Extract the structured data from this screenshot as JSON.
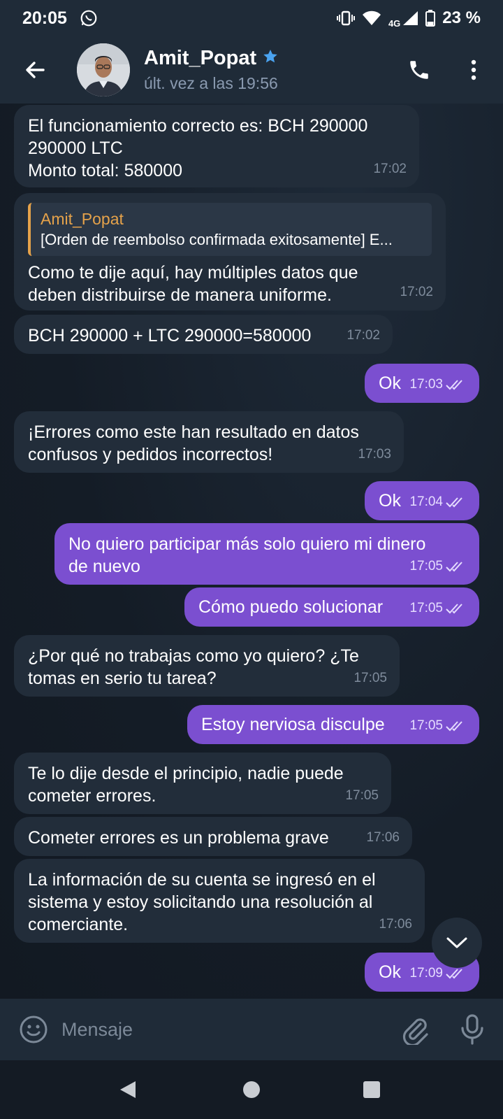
{
  "status_bar": {
    "time": "20:05",
    "network": "4G",
    "battery": "23 %"
  },
  "header": {
    "contact_name": "Amit_Popat",
    "last_seen": "últ. vez a las 19:56"
  },
  "messages": [
    {
      "dir": "in",
      "text": "El funcionamiento correcto es: BCH 290000\n290000 LTC\nMonto total: 580000",
      "time": "17:02"
    },
    {
      "dir": "in",
      "quote_name": "Amit_Popat",
      "quote_text": "[Orden de reembolso confirmada exitosamente] E...",
      "text": "Como te dije aquí, hay múltiples datos que\ndeben distribuirse de manera uniforme.",
      "time": "17:02"
    },
    {
      "dir": "in",
      "text": "BCH 290000 + LTC 290000=580000",
      "time": "17:02"
    },
    {
      "dir": "out",
      "text": "Ok",
      "time": "17:03"
    },
    {
      "dir": "in",
      "text": "¡Errores como este han resultado en datos\nconfusos y pedidos incorrectos!",
      "time": "17:03"
    },
    {
      "dir": "out",
      "text": "Ok",
      "time": "17:04"
    },
    {
      "dir": "out",
      "text": "No quiero participar más solo quiero mi dinero\nde nuevo",
      "time": "17:05"
    },
    {
      "dir": "out",
      "text": "Cómo puedo solucionar",
      "time": "17:05"
    },
    {
      "dir": "in",
      "text": "¿Por qué no trabajas como yo quiero? ¿Te\ntomas en serio tu tarea?",
      "time": "17:05"
    },
    {
      "dir": "out",
      "text": "Estoy nerviosa disculpe",
      "time": "17:05"
    },
    {
      "dir": "in",
      "text": "Te lo dije desde el principio, nadie puede\ncometer errores.",
      "time": "17:05"
    },
    {
      "dir": "in",
      "text": "Cometer errores es un problema grave",
      "time": "17:06"
    },
    {
      "dir": "in",
      "text": "La información de su cuenta se ingresó en el\nsistema y estoy solicitando una resolución al\ncomerciante.",
      "time": "17:06"
    },
    {
      "dir": "out",
      "text": "Ok",
      "time": "17:09"
    }
  ],
  "composer": {
    "placeholder": "Mensaje"
  },
  "colors": {
    "outgoing_bubble": "#7b4fd0",
    "incoming_bubble": "#222d3a",
    "accent_quote": "#e5a24a",
    "verified_star": "#4aa3f0"
  }
}
